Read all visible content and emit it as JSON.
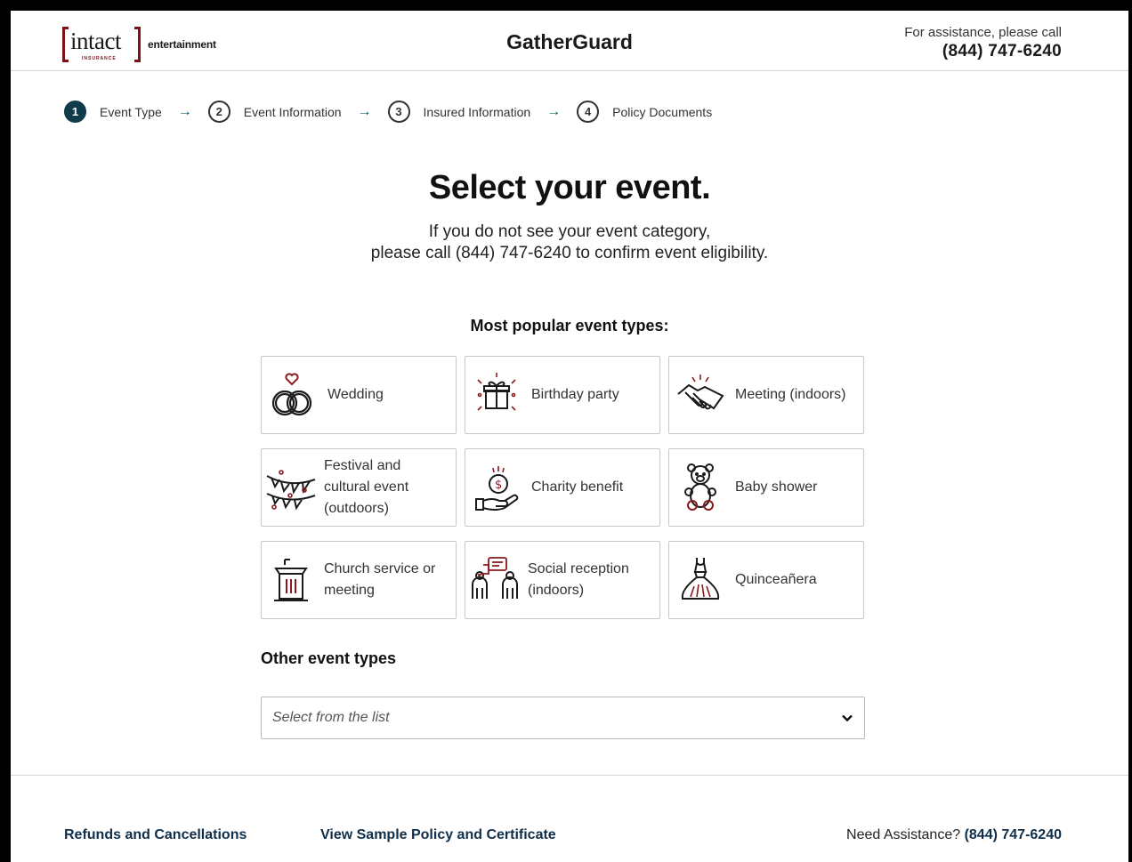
{
  "header": {
    "logo_word": "intact",
    "logo_sub": "INSURANCE",
    "logo_entertainment": "entertainment",
    "app_title": "GatherGuard",
    "assist_text": "For assistance, please call",
    "assist_phone": "(844) 747-6240"
  },
  "stepper": {
    "steps": [
      {
        "number": "1",
        "label": "Event Type",
        "active": true
      },
      {
        "number": "2",
        "label": "Event Information",
        "active": false
      },
      {
        "number": "3",
        "label": "Insured Information",
        "active": false
      },
      {
        "number": "4",
        "label": "Policy Documents",
        "active": false
      }
    ],
    "arrow": "→"
  },
  "main": {
    "title": "Select your event.",
    "subtitle_line1": "If you do not see your event category,",
    "subtitle_line2": "please call (844) 747-6240 to confirm event eligibility.",
    "popular_heading": "Most popular event types:",
    "cards": [
      {
        "label": "Wedding",
        "icon": "wedding-rings-icon"
      },
      {
        "label": "Birthday party",
        "icon": "gift-icon"
      },
      {
        "label": "Meeting (indoors)",
        "icon": "handshake-icon"
      },
      {
        "label": "Festival and cultural event (outdoors)",
        "icon": "bunting-icon"
      },
      {
        "label": "Charity benefit",
        "icon": "donation-hand-icon"
      },
      {
        "label": "Baby shower",
        "icon": "teddy-bear-icon"
      },
      {
        "label": "Church service or meeting",
        "icon": "podium-icon"
      },
      {
        "label": "Social reception (indoors)",
        "icon": "people-chat-icon"
      },
      {
        "label": "Quinceañera",
        "icon": "dress-icon"
      }
    ],
    "other_heading": "Other event types",
    "select_placeholder": "Select from the list"
  },
  "footer": {
    "refunds": "Refunds and Cancellations",
    "sample": "View Sample Policy and Certificate",
    "assist_label": "Need Assistance?",
    "assist_phone": "(844) 747-6240"
  },
  "colors": {
    "accent_dark": "#0f3b4a",
    "brand_red": "#7a1216",
    "link": "#0f2f4a"
  }
}
